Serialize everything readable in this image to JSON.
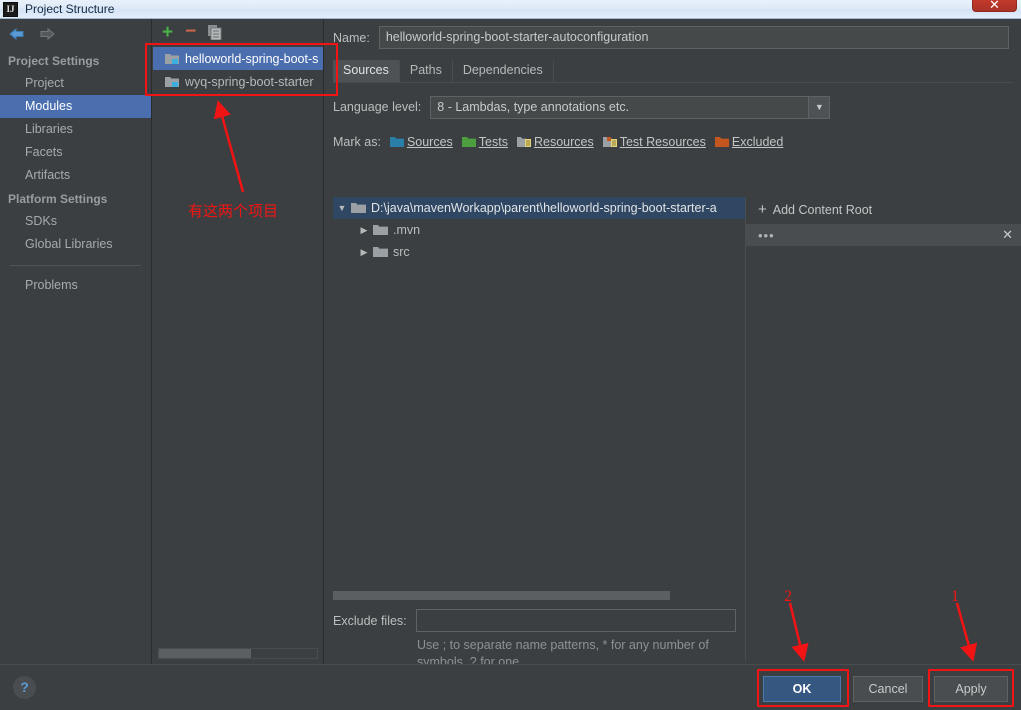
{
  "window": {
    "title": "Project Structure",
    "app_icon": "intellij-idea-icon",
    "close_label": "✕"
  },
  "nav": {
    "back_icon": "arrow-left-icon",
    "forward_icon": "arrow-right-icon"
  },
  "sidebar": {
    "groups": [
      {
        "label": "Project Settings",
        "items": [
          {
            "label": "Project",
            "selected": false
          },
          {
            "label": "Modules",
            "selected": true
          },
          {
            "label": "Libraries",
            "selected": false
          },
          {
            "label": "Facets",
            "selected": false
          },
          {
            "label": "Artifacts",
            "selected": false
          }
        ]
      },
      {
        "label": "Platform Settings",
        "items": [
          {
            "label": "SDKs",
            "selected": false
          },
          {
            "label": "Global Libraries",
            "selected": false
          }
        ]
      }
    ],
    "problems": {
      "label": "Problems"
    }
  },
  "modules_panel": {
    "toolbar": {
      "add_icon": "plus-icon",
      "remove_icon": "minus-icon",
      "copy_icon": "copy-icon"
    },
    "modules": [
      {
        "label": "helloworld-spring-boot-s",
        "selected": true
      },
      {
        "label": "wyq-spring-boot-starter",
        "selected": false
      }
    ]
  },
  "main": {
    "name_label": "Name:",
    "name_value": "helloworld-spring-boot-starter-autoconfiguration",
    "tabs": [
      {
        "label": "Sources",
        "selected": true
      },
      {
        "label": "Paths",
        "selected": false
      },
      {
        "label": "Dependencies",
        "selected": false
      }
    ],
    "language_level_label": "Language level:",
    "language_level_value": "8 - Lambdas, type annotations etc.",
    "mark_as_label": "Mark as:",
    "mark_as": [
      {
        "label": "Sources",
        "icon": "folder-sources-icon",
        "color": "#2a7fa8"
      },
      {
        "label": "Tests",
        "icon": "folder-tests-icon",
        "color": "#4c9e3f"
      },
      {
        "label": "Resources",
        "icon": "folder-resources-icon",
        "color": "#9aa0a3"
      },
      {
        "label": "Test Resources",
        "icon": "folder-test-resources-icon",
        "color": "#9aa0a3"
      },
      {
        "label": "Excluded",
        "icon": "folder-excluded-icon",
        "color": "#c4561f"
      }
    ],
    "tree": [
      {
        "label": "D:\\java\\mavenWorkapp\\parent\\helloworld-spring-boot-starter-a",
        "twisty": "▼",
        "depth": 0,
        "selected": true
      },
      {
        "label": ".mvn",
        "twisty": "▶",
        "depth": 1,
        "selected": false
      },
      {
        "label": "src",
        "twisty": "▶",
        "depth": 1,
        "selected": false
      }
    ],
    "exclude_label": "Exclude files:",
    "exclude_value": "",
    "exclude_hint": "Use ; to separate name patterns, * for any number of symbols, ? for one.",
    "content_root": {
      "add_label": "Add Content Root",
      "add_icon": "plus-icon",
      "entry_dots": "•••",
      "remove_icon": "close-icon"
    }
  },
  "footer": {
    "help_label": "?",
    "help_icon": "help-icon",
    "ok_label": "OK",
    "cancel_label": "Cancel",
    "apply_label": "Apply"
  },
  "annotations": {
    "modules_note": "有这两个项目",
    "ok_number": "2",
    "apply_number": "1",
    "color": "#f21414"
  }
}
